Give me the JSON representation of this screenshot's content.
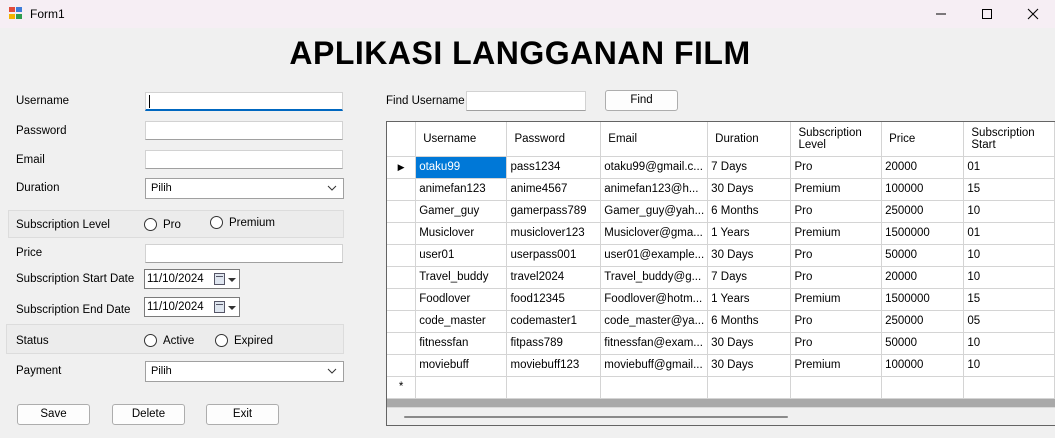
{
  "window": {
    "title": "Form1",
    "icon_colors": [
      "#e14b3b",
      "#3d7bd8",
      "#f4b400",
      "#2e9d4f"
    ]
  },
  "app_title": "APLIKASI LANGGANAN FILM",
  "form": {
    "username_label": "Username",
    "password_label": "Password",
    "email_label": "Email",
    "duration_label": "Duration",
    "duration_value": "Pilih",
    "subscription_level_label": "Subscription Level",
    "level_option_pro": "Pro",
    "level_option_premium": "Premium",
    "price_label": "Price",
    "start_date_label": "Subscription Start Date",
    "start_date_value": "11/10/2024",
    "end_date_label": "Subscription End Date",
    "end_date_value": "11/10/2024",
    "status_label": "Status",
    "status_option_active": "Active",
    "status_option_expired": "Expired",
    "payment_label": "Payment",
    "payment_value": "Pilih"
  },
  "buttons": {
    "save": "Save",
    "delete": "Delete",
    "exit": "Exit",
    "find": "Find"
  },
  "search": {
    "label": "Find Username"
  },
  "grid": {
    "columns": [
      "Username",
      "Password",
      "Email",
      "Duration",
      "Subscription Level",
      "Price",
      "Subscription Start"
    ],
    "rows": [
      [
        "otaku99",
        "pass1234",
        "otaku99@gmail.c...",
        "7 Days",
        "Pro",
        "20000",
        "01"
      ],
      [
        "animefan123",
        "anime4567",
        "animefan123@h...",
        "30 Days",
        "Premium",
        "100000",
        "15"
      ],
      [
        "Gamer_guy",
        "gamerpass789",
        "Gamer_guy@yah...",
        "6 Months",
        "Pro",
        "250000",
        "10"
      ],
      [
        "Musiclover",
        "musiclover123",
        "Musiclover@gma...",
        "1 Years",
        "Premium",
        "1500000",
        "01"
      ],
      [
        "user01",
        "userpass001",
        "user01@example...",
        "30 Days",
        "Pro",
        "50000",
        "10"
      ],
      [
        "Travel_buddy",
        "travel2024",
        "Travel_buddy@g...",
        "7 Days",
        "Pro",
        "20000",
        "10"
      ],
      [
        "Foodlover",
        "food12345",
        "Foodlover@hotm...",
        "1 Years",
        "Premium",
        "1500000",
        "15"
      ],
      [
        "code_master",
        "codemaster1",
        "code_master@ya...",
        "6 Months",
        "Pro",
        "250000",
        "05"
      ],
      [
        "fitnessfan",
        "fitpass789",
        "fitnessfan@exam...",
        "30 Days",
        "Pro",
        "50000",
        "10"
      ],
      [
        "moviebuff",
        "moviebuff123",
        "moviebuff@gmail...",
        "30 Days",
        "Premium",
        "100000",
        "10"
      ]
    ],
    "current_row_marker": "▶",
    "new_row_marker": "*",
    "selection_color": "#0078d7"
  }
}
